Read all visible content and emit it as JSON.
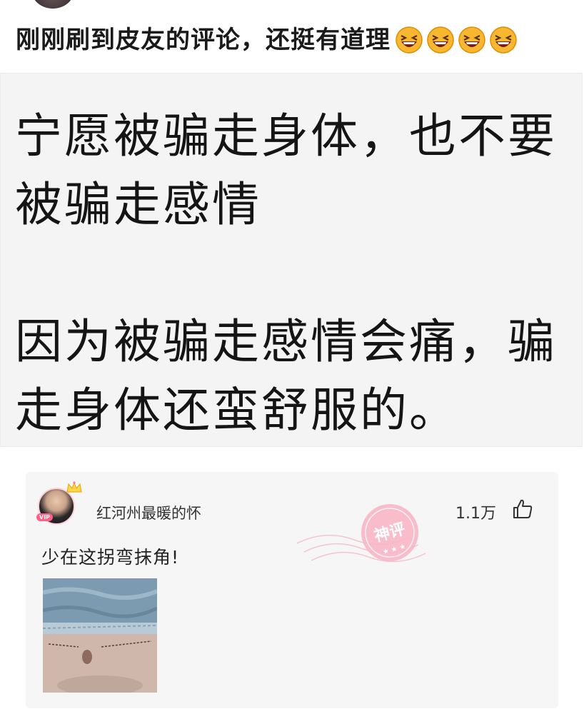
{
  "post": {
    "title": "刚刚刷到皮友的评论，还挺有道理",
    "emoji_count": 4,
    "emoji_name": "laughing-face-icon"
  },
  "quote_image": {
    "lines": [
      "宁愿被骗走身体，也不要",
      "被骗走感情",
      "",
      "因为被骗走感情会痛，骗",
      "走身体还蛮舒服的。"
    ]
  },
  "comment": {
    "username": "红河州最暖的怀",
    "badge": "神评",
    "likes": "1.1万",
    "text": "少在这拐弯抹角!",
    "colors": {
      "stamp": "#f4a8bb",
      "card_bg": "#f6f6f6"
    }
  }
}
